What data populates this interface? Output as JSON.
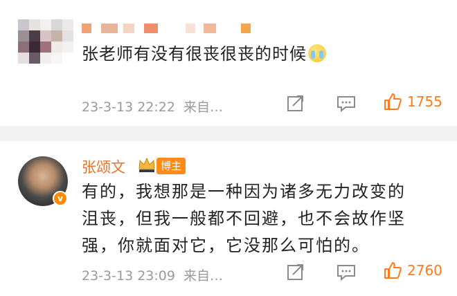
{
  "comments": [
    {
      "text": "张老师有没有很丧很丧的时候",
      "emoji": "crying-face-icon",
      "time": "23-3-13 22:22",
      "source": "来自…",
      "likes": "1755"
    },
    {
      "author": "张颂文",
      "badge": "博主",
      "text_lines": [
        "有的，我想那是一种因为诸多无力改变的",
        "沮丧，但我一般都不回避，也不会故作坚",
        "强，你就面对它，它没那么可怕的。"
      ],
      "time": "23-3-13 23:09",
      "source": "来自…",
      "likes": "2760",
      "verified_mark": "v"
    }
  ],
  "colors": {
    "like": "#ff7a1a",
    "author": "#e8732a",
    "badge": "#ff8c1a",
    "meta": "#9a9a9a",
    "divider": "#f2f2f2"
  }
}
